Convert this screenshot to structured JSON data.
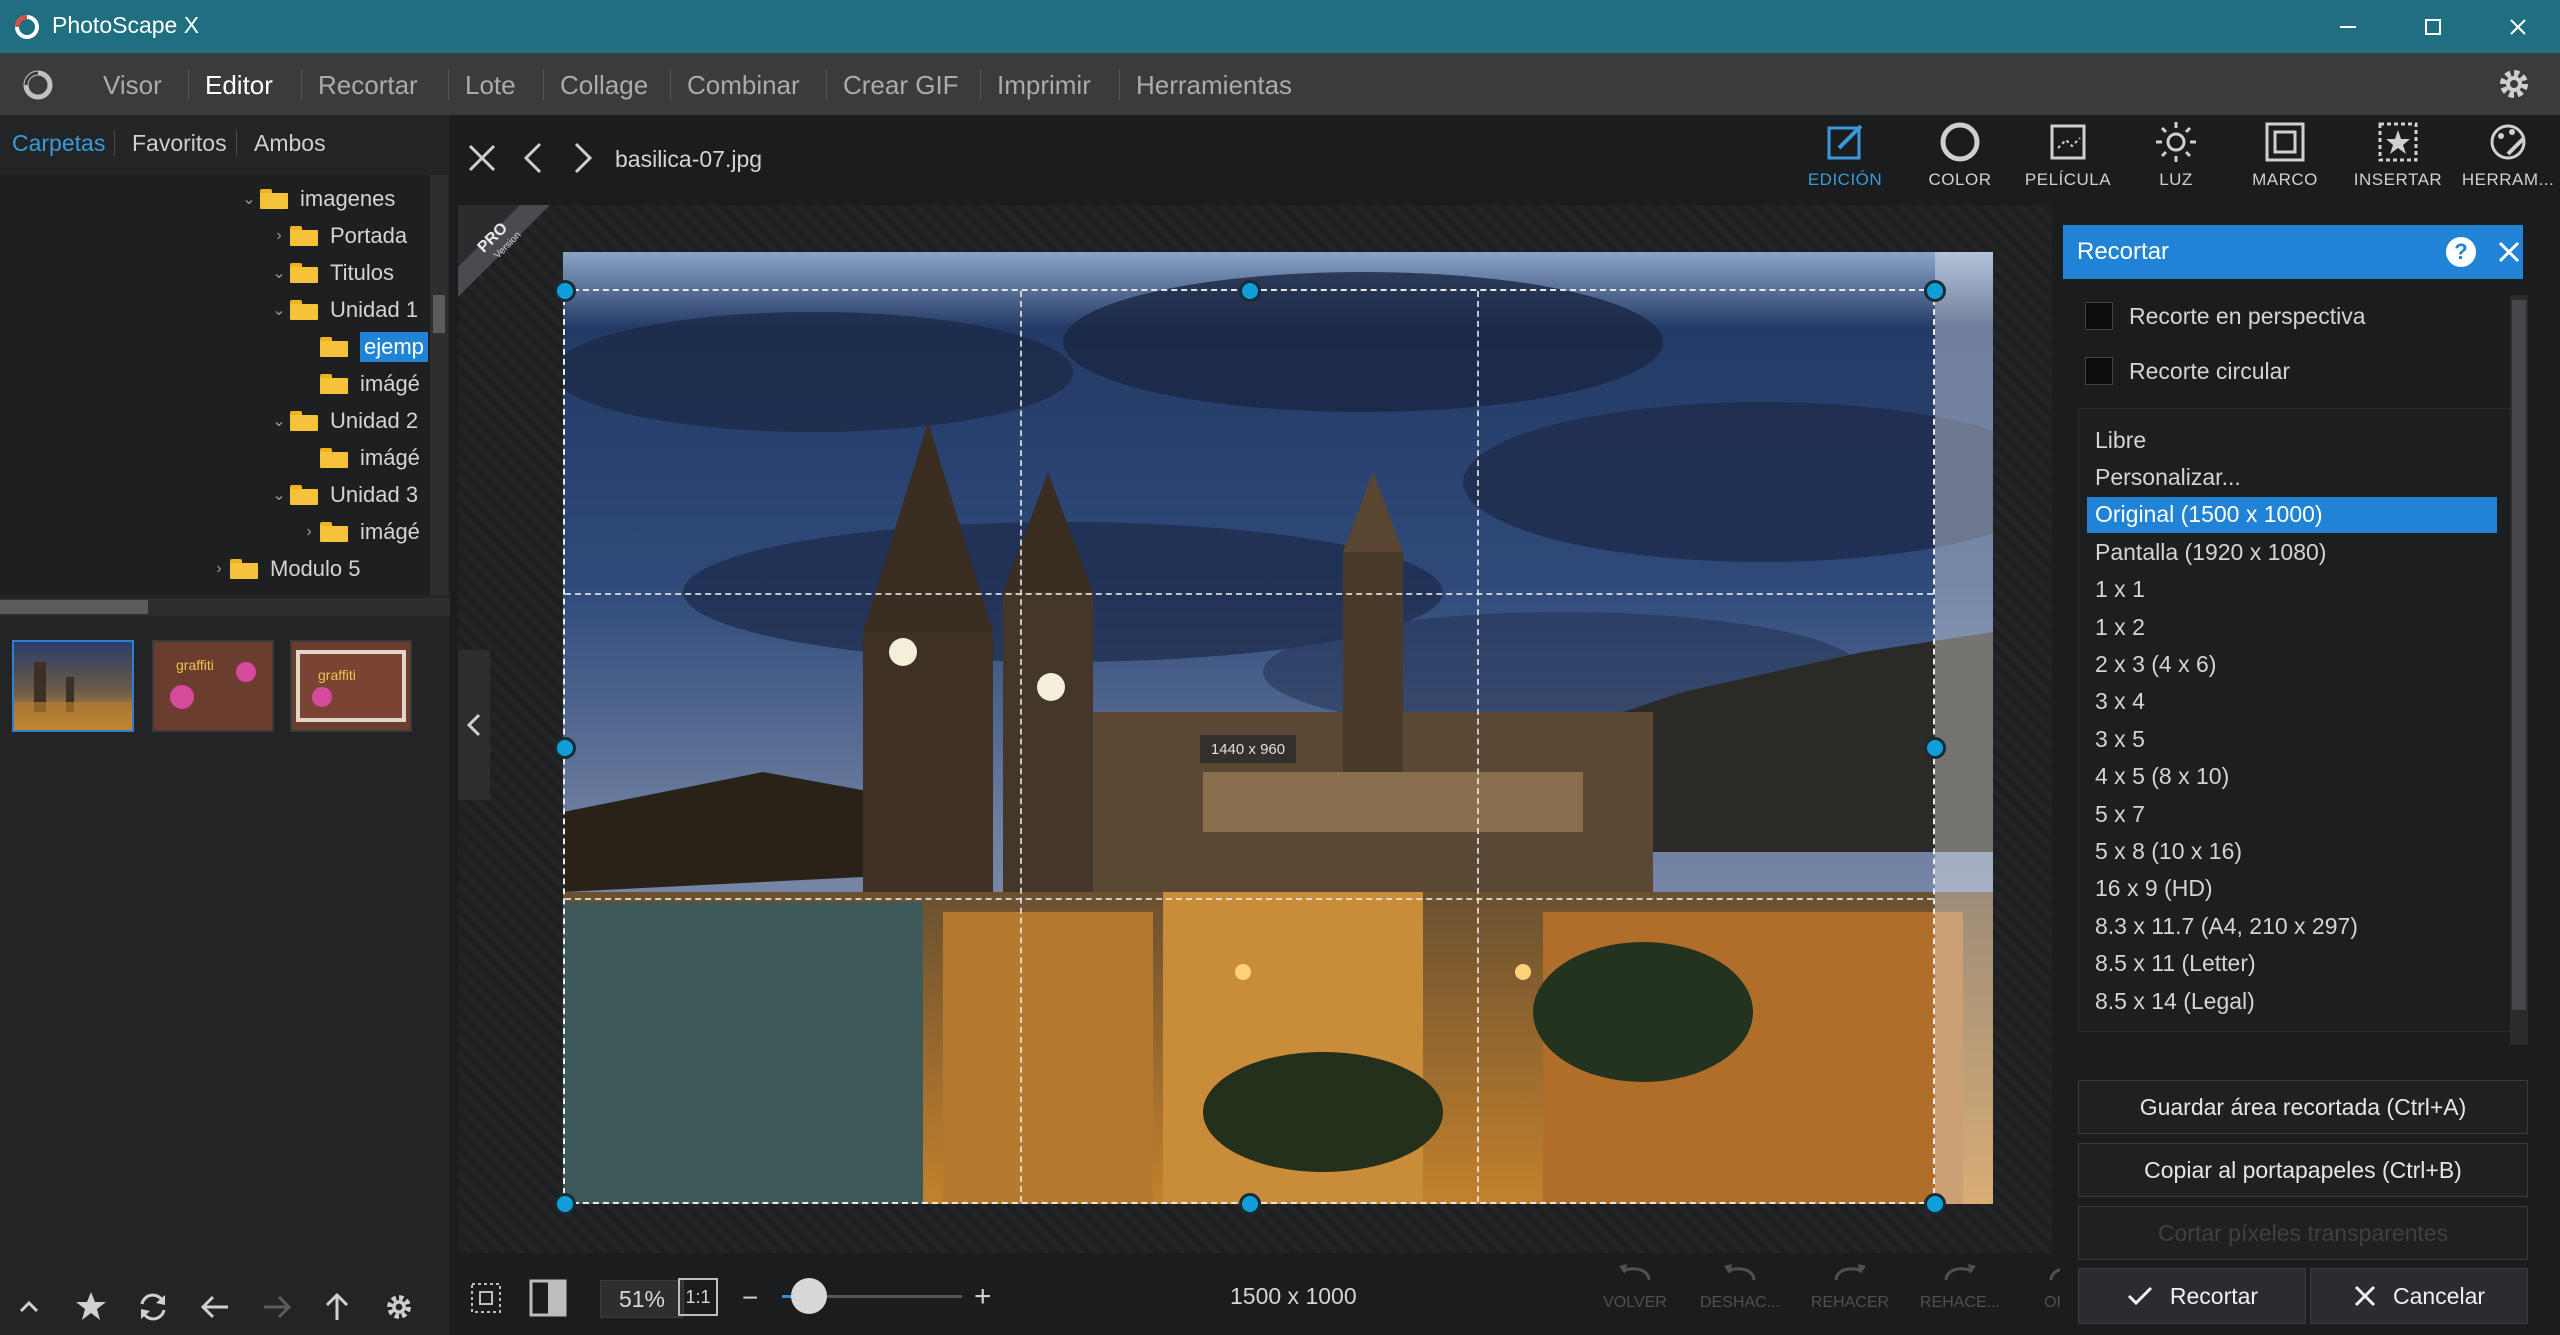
{
  "app": {
    "title": "PhotoScape X"
  },
  "menu": {
    "items": [
      "Visor",
      "Editor",
      "Recortar",
      "Lote",
      "Collage",
      "Combinar",
      "Crear GIF",
      "Imprimir",
      "Herramientas"
    ],
    "active": "Editor"
  },
  "left_tabs": [
    "Carpetas",
    "Favoritos",
    "Ambos"
  ],
  "tree": [
    {
      "label": "imagenes",
      "expanded": true
    },
    {
      "label": "Portada",
      "expanded": false
    },
    {
      "label": "Titulos",
      "expanded": true
    },
    {
      "label": "Unidad 1",
      "expanded": true
    },
    {
      "label": "ejemp",
      "selected": true
    },
    {
      "label": "imágé"
    },
    {
      "label": "Unidad 2",
      "expanded": true
    },
    {
      "label": "imágé"
    },
    {
      "label": "Unidad 3",
      "expanded": true
    },
    {
      "label": "imágé",
      "expanded": false
    },
    {
      "label": "Modulo 5",
      "expanded": false
    }
  ],
  "toolbar": {
    "filename": "basilica-07.jpg",
    "tools": [
      {
        "label": "EDICIÓN",
        "icon": "edit-icon",
        "active": true
      },
      {
        "label": "COLOR",
        "icon": "color-icon"
      },
      {
        "label": "PELÍCULA",
        "icon": "film-icon"
      },
      {
        "label": "LUZ",
        "icon": "light-icon"
      },
      {
        "label": "MARCO",
        "icon": "frame-icon"
      },
      {
        "label": "INSERTAR",
        "icon": "insert-icon"
      },
      {
        "label": "HERRAM...",
        "icon": "tools-icon"
      }
    ]
  },
  "canvas": {
    "pro_badge": "PRO",
    "pro_sub": "Version",
    "crop_size_label": "1440 x 960"
  },
  "bottom": {
    "zoom": "51%",
    "zoom_reset": "1:1",
    "dimensions": "1500 x 1000",
    "zoom_slider_value": 0.15,
    "history": [
      "VOLVER",
      "DESHAC...",
      "REHACER",
      "REHACE...",
      "ORI..."
    ]
  },
  "crop_panel": {
    "title": "Recortar",
    "options": [
      "Recorte en perspectiva",
      "Recorte circular"
    ],
    "ratios": [
      "Libre",
      "Personalizar...",
      "Original (1500 x 1000)",
      "Pantalla (1920 x 1080)",
      "1 x 1",
      "1 x 2",
      "2 x 3 (4 x 6)",
      "3 x 4",
      "3 x 5",
      "4 x 5 (8 x 10)",
      "5 x 7",
      "5 x 8 (10 x 16)",
      "16 x 9 (HD)",
      "8.3 x 11.7 (A4, 210 x 297)",
      "8.5 x 11 (Letter)",
      "8.5 x 14 (Legal)"
    ],
    "selected_ratio": "Original (1500 x 1000)",
    "save_button": "Guardar área recortada (Ctrl+A)",
    "copy_button": "Copiar al portapapeles (Ctrl+B)",
    "transparent_button": "Cortar píxeles transparentes",
    "crop_button": "Recortar",
    "cancel_button": "Cancelar"
  },
  "colors": {
    "titlebar": "#1f6f80",
    "accent": "#2183d6",
    "menubar": "#3a3b3d"
  }
}
